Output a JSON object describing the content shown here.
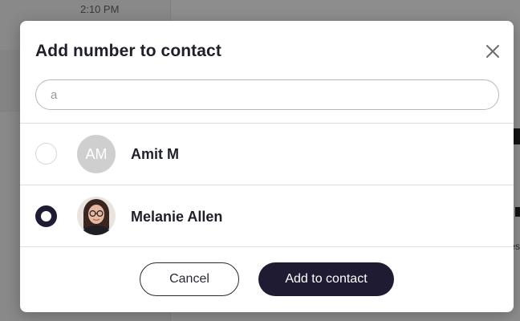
{
  "background": {
    "time": "2:10 PM",
    "right_edge_text": "es"
  },
  "modal": {
    "title": "Add number to contact",
    "close_icon": "close-icon",
    "search": {
      "value": "a",
      "placeholder": ""
    },
    "contacts": [
      {
        "name": "Amit M",
        "initials": "AM",
        "selected": false,
        "avatar": "initials"
      },
      {
        "name": "Melanie Allen",
        "initials": "",
        "selected": true,
        "avatar": "photo"
      }
    ],
    "cancel_label": "Cancel",
    "add_label": "Add to contact"
  },
  "colors": {
    "primary": "#1f1b33",
    "avatar_gray": "#cfcfcf",
    "overlay": "rgba(0,0,0,0.44)"
  }
}
